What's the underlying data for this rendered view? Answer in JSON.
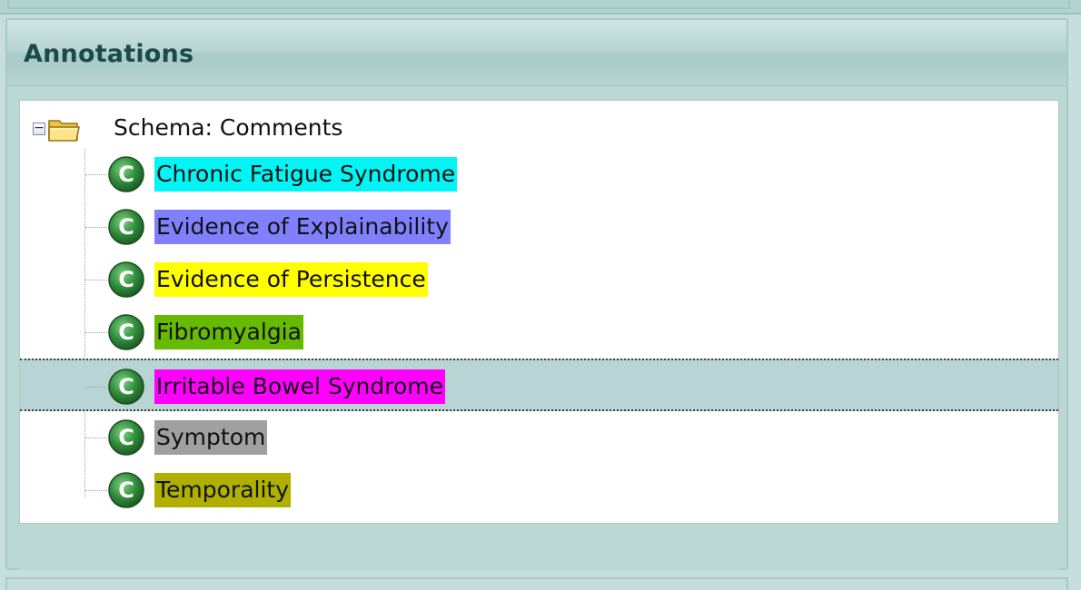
{
  "panel": {
    "title": "Annotations"
  },
  "tree": {
    "root_label": "Schema: Comments",
    "expander_symbol": "−",
    "items": [
      {
        "label": "Chronic Fatigue Syndrome",
        "color": "#00f5f5",
        "selected": false
      },
      {
        "label": "Evidence of Explainability",
        "color": "#8080ff",
        "selected": false
      },
      {
        "label": "Evidence of Persistence",
        "color": "#ffff00",
        "selected": false
      },
      {
        "label": "Fibromyalgia",
        "color": "#66bb00",
        "selected": false
      },
      {
        "label": "Irritable Bowel Syndrome",
        "color": "#ff00ff",
        "selected": true
      },
      {
        "label": "Symptom",
        "color": "#a0a0a0",
        "selected": false
      },
      {
        "label": "Temporality",
        "color": "#b0b000",
        "selected": false
      }
    ]
  },
  "icons": {
    "root": "folder-open-icon",
    "expander": "collapse-icon",
    "item": "class-c-icon"
  },
  "colors": {
    "accent": "#1c4a4a",
    "panel_bg": "#bcd8d5",
    "selection_bg": "#b9d4d4",
    "icon_green": "#2e8b3a"
  }
}
